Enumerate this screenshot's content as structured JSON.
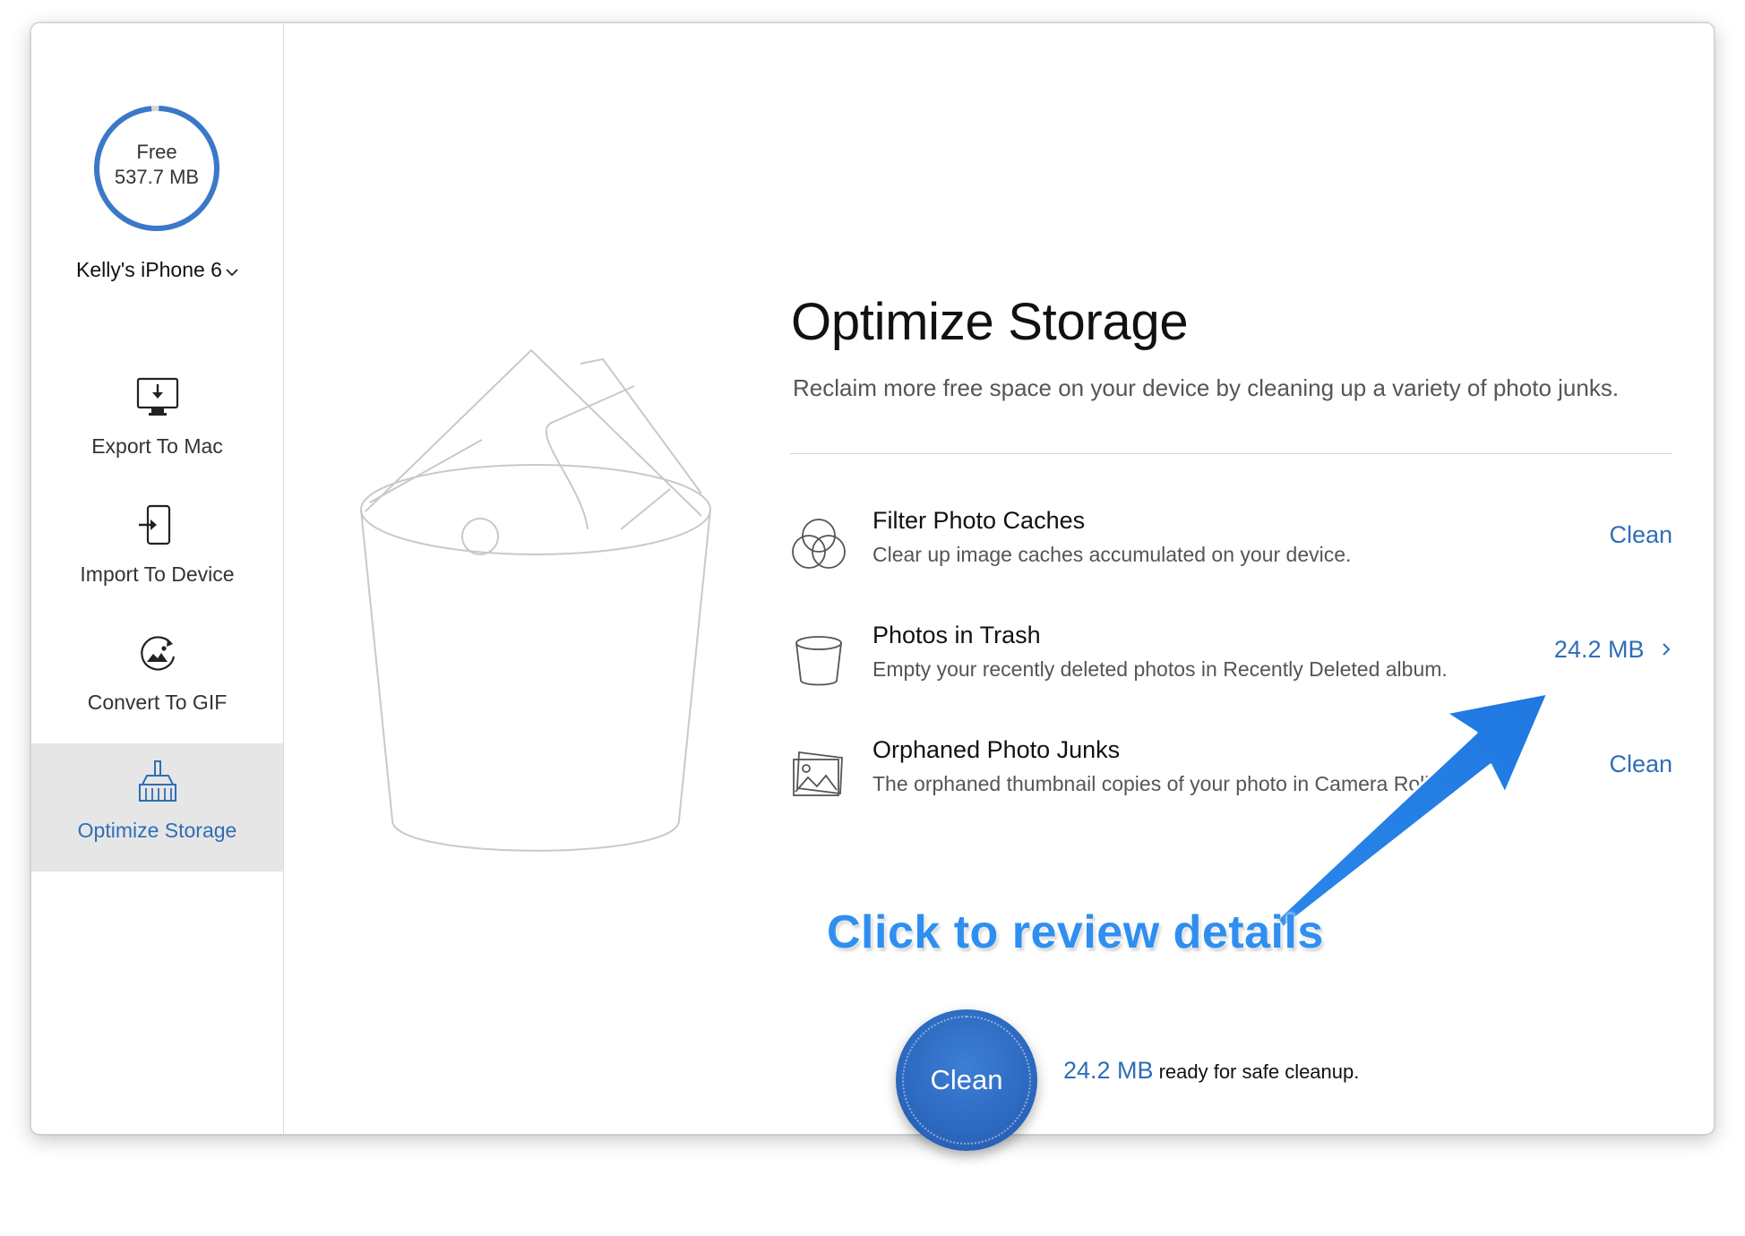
{
  "window": {
    "controls": [
      "close",
      "minimize"
    ]
  },
  "sidebar": {
    "storage": {
      "label": "Free",
      "value": "537.7 MB",
      "used_fraction": 0.98
    },
    "device": {
      "name": "Kelly's iPhone 6"
    },
    "items": [
      {
        "label": "Export To Mac",
        "icon": "monitor-download-icon",
        "active": false
      },
      {
        "label": "Import To Device",
        "icon": "phone-import-icon",
        "active": false
      },
      {
        "label": "Convert To GIF",
        "icon": "gif-convert-icon",
        "active": false
      },
      {
        "label": "Optimize Storage",
        "icon": "broom-icon",
        "active": true
      }
    ]
  },
  "main": {
    "title": "Optimize Storage",
    "subtitle": "Reclaim more free space on your device by cleaning up a variety of photo junks.",
    "rows": [
      {
        "title": "Filter Photo Caches",
        "description": "Clear up image caches accumulated on your device.",
        "action": "Clean",
        "icon": "filter-circles-icon"
      },
      {
        "title": "Photos in Trash",
        "description": "Empty your recently deleted photos in Recently Deleted album.",
        "action": "24.2 MB",
        "icon": "trash-bin-icon"
      },
      {
        "title": "Orphaned Photo Junks",
        "description": "The orphaned thumbnail copies of your photo in Camera Roll.",
        "action": "Clean",
        "icon": "photo-stack-icon"
      }
    ],
    "annotation": "Click to review details",
    "clean_button": "Clean",
    "status": {
      "size": "24.2 MB",
      "text": "ready for safe cleanup."
    }
  },
  "colors": {
    "accent": "#2f6db8",
    "annotation": "#2f8ff0",
    "close": "#fc5f57",
    "minimize": "#fdbc2e",
    "active_bg": "#e6e6e6"
  }
}
